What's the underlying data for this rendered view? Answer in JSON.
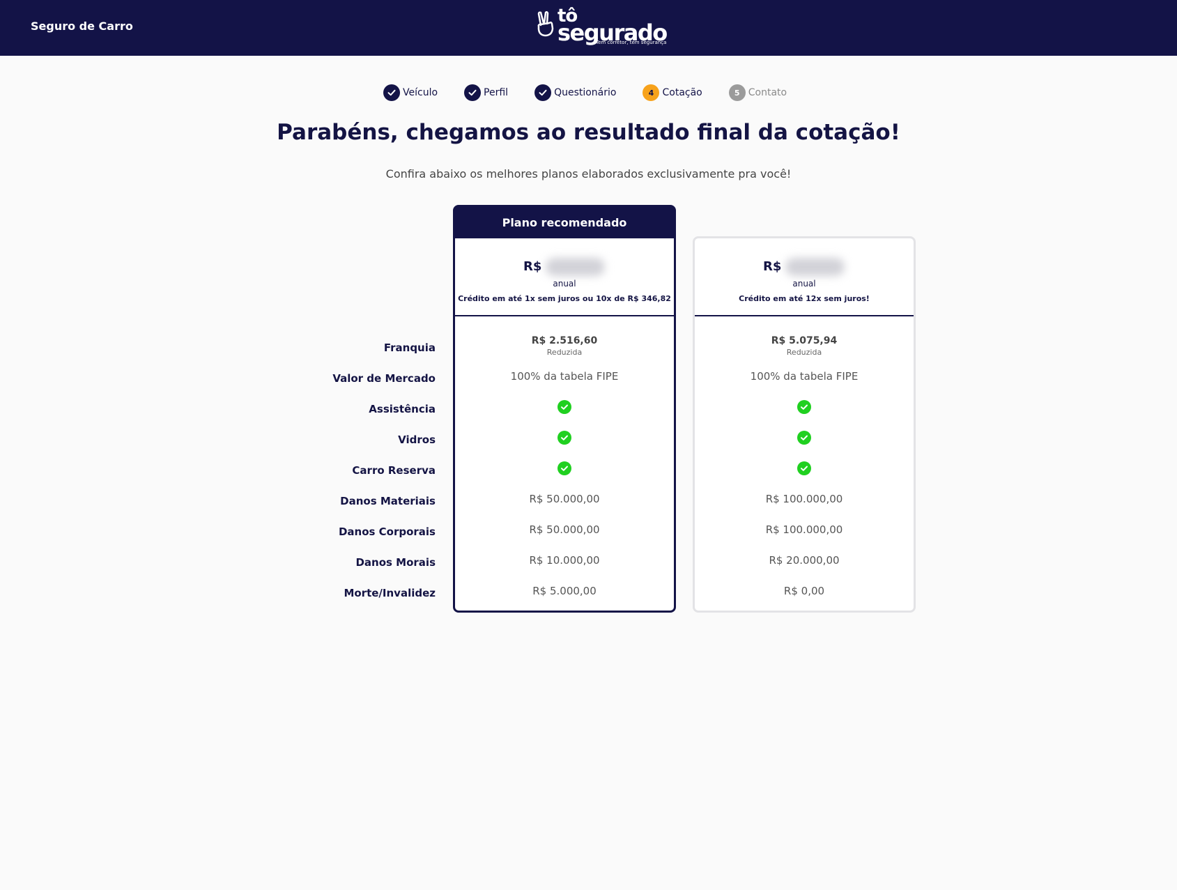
{
  "header": {
    "page_label": "Seguro de Carro",
    "logo": {
      "line1": "tô",
      "line2": "segurado",
      "tagline": "Tem corretor, tem segurança"
    }
  },
  "steps": [
    {
      "number": "1",
      "label": "Veículo",
      "status": "done"
    },
    {
      "number": "2",
      "label": "Perfil",
      "status": "done"
    },
    {
      "number": "3",
      "label": "Questionário",
      "status": "done"
    },
    {
      "number": "4",
      "label": "Cotação",
      "status": "current"
    },
    {
      "number": "5",
      "label": "Contato",
      "status": "todo"
    }
  ],
  "main": {
    "title": "Parabéns, chegamos ao resultado final da cotação!",
    "subtitle": "Confira abaixo os melhores planos elaborados exclusivamente pra você!"
  },
  "row_labels": [
    "Franquia",
    "Valor de Mercado",
    "Assistência",
    "Vidros",
    "Carro Reserva",
    "Danos Materiais",
    "Danos Corporais",
    "Danos Morais",
    "Morte/Invalidez"
  ],
  "plans": [
    {
      "badge": "Plano recomendado",
      "currency": "R$",
      "period": "anual",
      "credit": "Crédito em até 1x sem juros ou 10x de R$ 346,82",
      "franquia_value": "R$ 2.516,60",
      "franquia_type": "Reduzida",
      "valor_mercado": "100% da tabela FIPE",
      "assistencia": true,
      "vidros": true,
      "carro_reserva": true,
      "danos_materiais": "R$ 50.000,00",
      "danos_corporais": "R$ 50.000,00",
      "danos_morais": "R$ 10.000,00",
      "morte_invalidez": "R$ 5.000,00"
    },
    {
      "currency": "R$",
      "period": "anual",
      "credit": "Crédito em até 12x sem juros!",
      "franquia_value": "R$ 5.075,94",
      "franquia_type": "Reduzida",
      "valor_mercado": "100% da tabela FIPE",
      "assistencia": true,
      "vidros": true,
      "carro_reserva": true,
      "danos_materiais": "R$ 100.000,00",
      "danos_corporais": "R$ 100.000,00",
      "danos_morais": "R$ 20.000,00",
      "morte_invalidez": "R$ 0,00"
    }
  ],
  "colors": {
    "navy": "#131347",
    "accent": "#f7a21b",
    "check": "#20d020",
    "inactive": "#9b9b9b"
  }
}
